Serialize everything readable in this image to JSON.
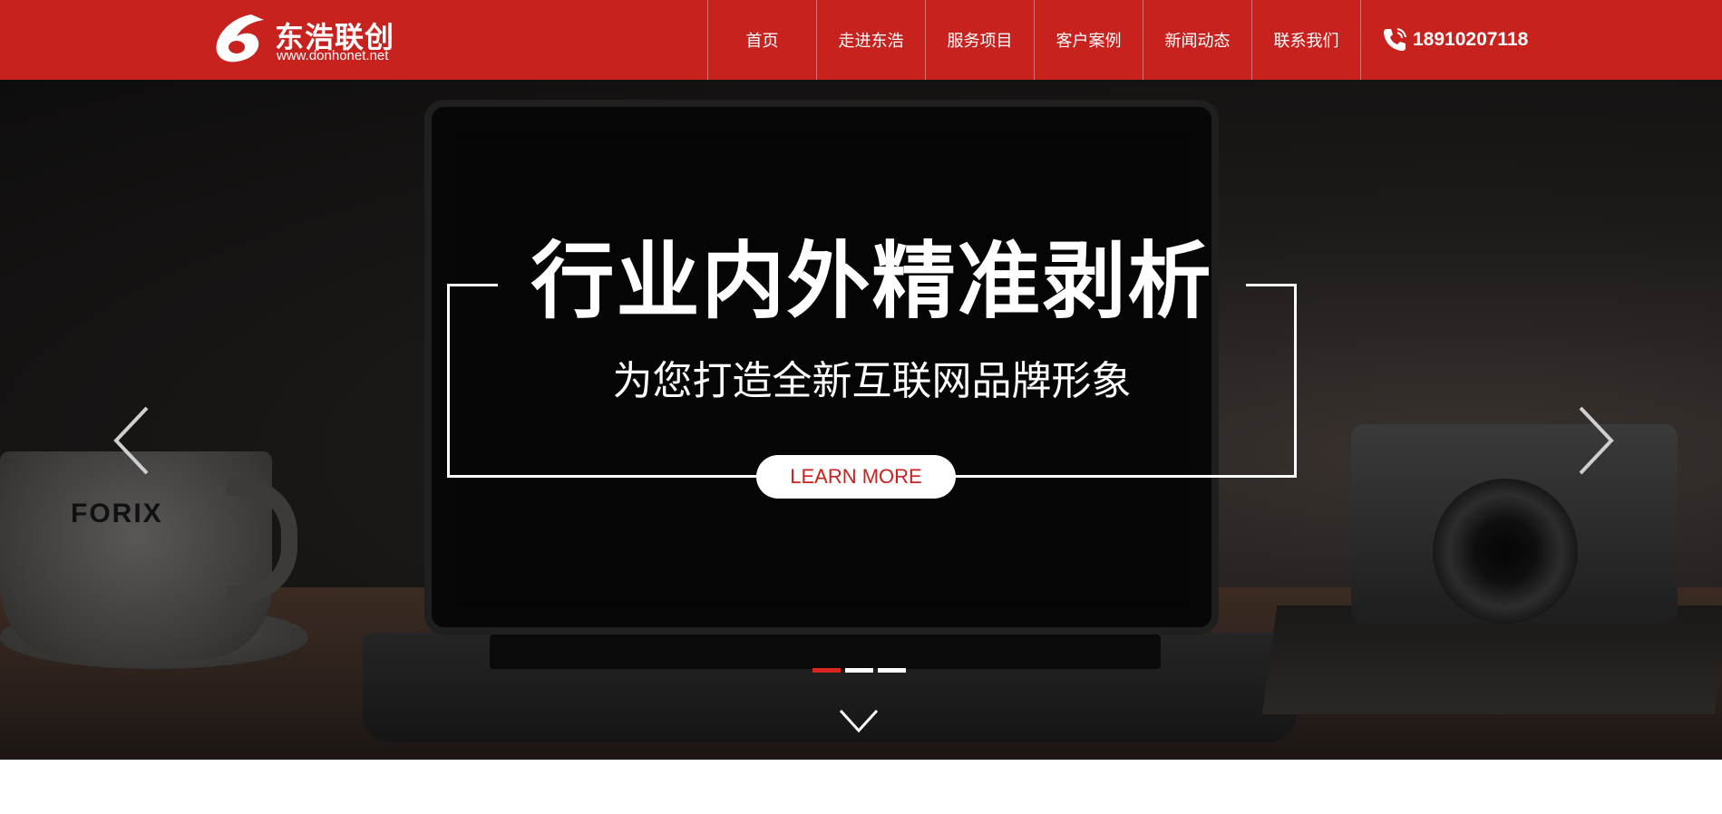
{
  "header": {
    "brand_name": "东浩联创",
    "brand_url": "www.donhonet.net",
    "brand_color": "#c8221f",
    "nav": [
      {
        "label": "首页"
      },
      {
        "label": "走进东浩"
      },
      {
        "label": "服务项目"
      },
      {
        "label": "客户案例"
      },
      {
        "label": "新闻动态"
      },
      {
        "label": "联系我们"
      }
    ],
    "phone_icon": "phone-icon",
    "phone": "18910207118"
  },
  "banner": {
    "headline": "行业内外精准剥析",
    "subline": "为您打造全新互联网品牌形象",
    "button_label": "LEARN MORE",
    "cup_brand": "FORIX",
    "prev_icon": "chevron-left-icon",
    "next_icon": "chevron-right-icon",
    "scroll_icon": "chevron-down-icon",
    "active_slide": 1,
    "slide_count": 3,
    "active_dot_color": "#d92522"
  }
}
